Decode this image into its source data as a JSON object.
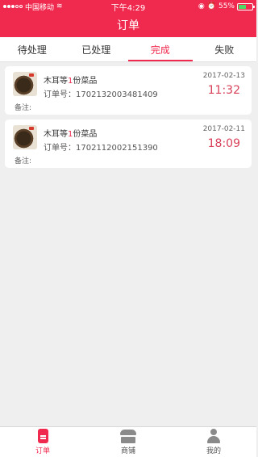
{
  "status_bar": {
    "carrier": "中国移动",
    "time": "下午4:29",
    "battery_text": "55%",
    "battery_level": 0.55
  },
  "nav": {
    "title": "订单"
  },
  "tabs": [
    {
      "label": "待处理"
    },
    {
      "label": "已处理"
    },
    {
      "label": "完成"
    },
    {
      "label": "失败"
    }
  ],
  "active_tab": "完成",
  "orders": [
    {
      "title_prefix": "木耳等",
      "count": "1",
      "title_suffix": "份菜品",
      "order_no_label": "订单号：",
      "order_no": "1702132003481409",
      "remark_label": "备注:",
      "date": "2017-02-13",
      "time": "11:32"
    },
    {
      "title_prefix": "木耳等",
      "count": "1",
      "title_suffix": "份菜品",
      "order_no_label": "订单号：",
      "order_no": "1702112002151390",
      "remark_label": "备注:",
      "date": "2017-02-11",
      "time": "18:09"
    }
  ],
  "bottom_nav": [
    {
      "label": "订单",
      "icon": "order-icon"
    },
    {
      "label": "商铺",
      "icon": "shop-icon"
    },
    {
      "label": "我的",
      "icon": "profile-icon"
    }
  ],
  "colors": {
    "accent": "#f0294e",
    "time": "#d9415a",
    "background": "#efefef"
  }
}
